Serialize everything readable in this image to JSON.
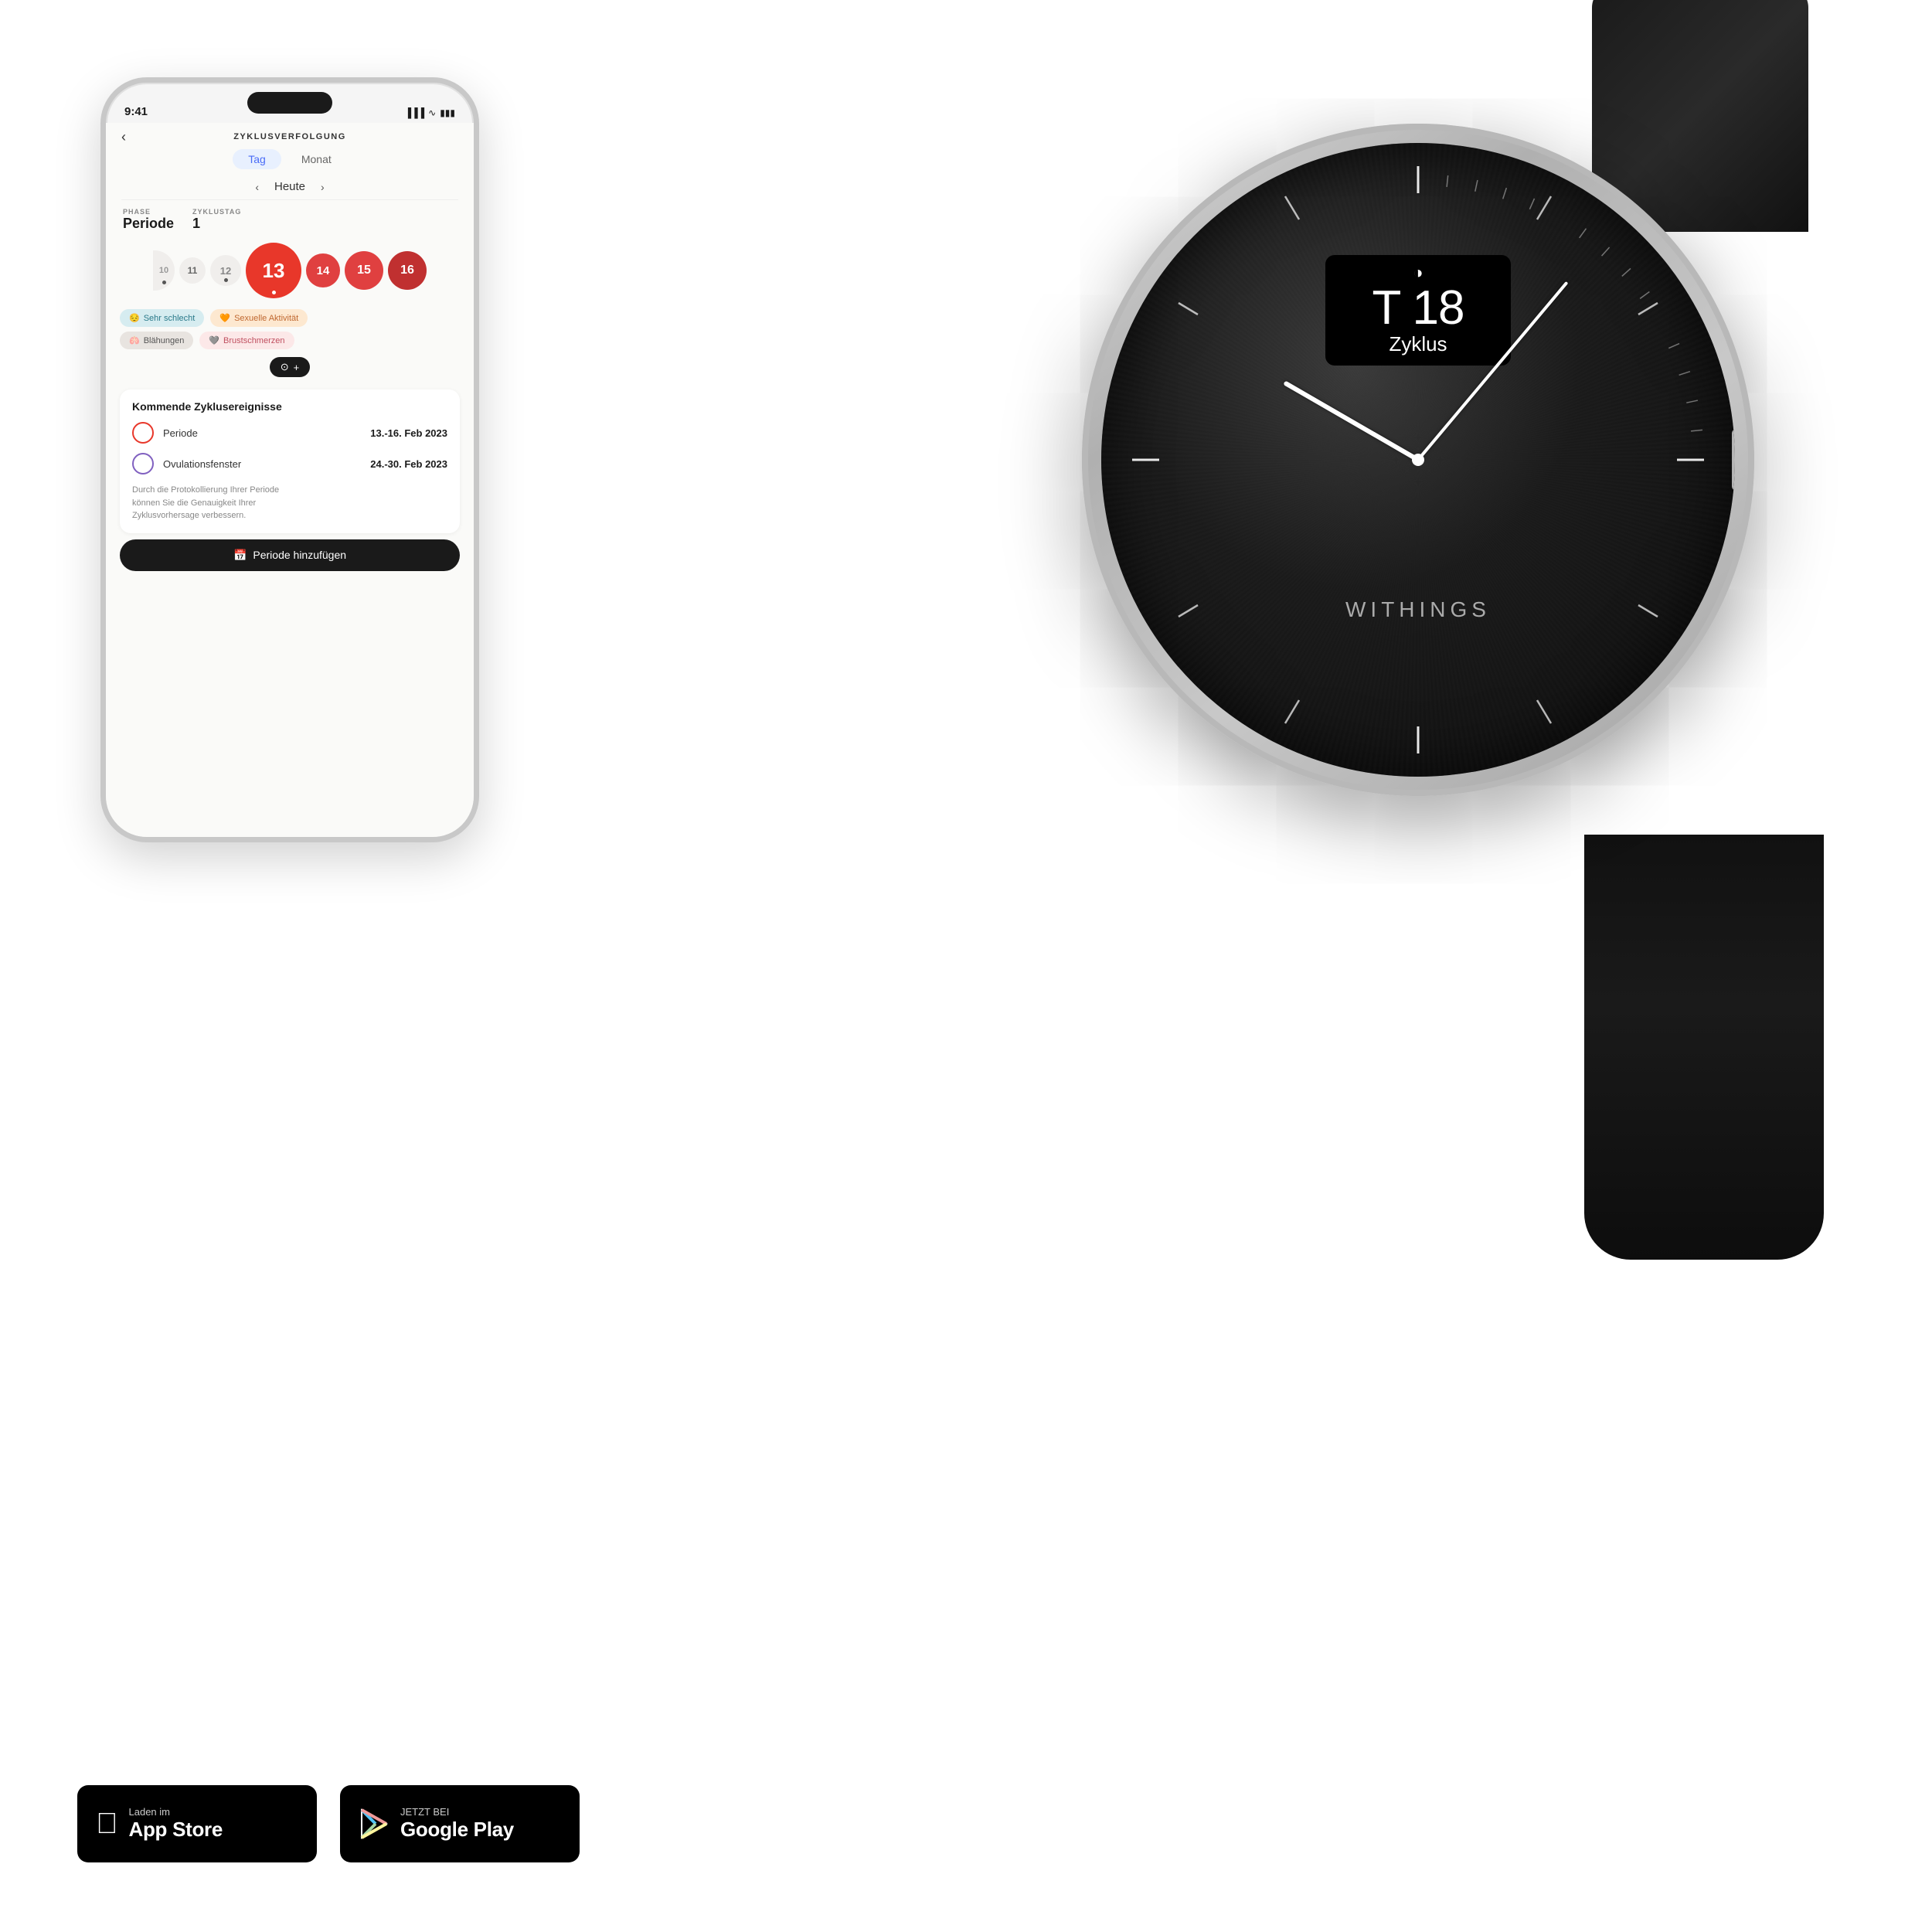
{
  "phone": {
    "status_time": "9:41",
    "app_title": "Zyklusverfolgung",
    "tab_tag": "Tag",
    "tab_monat": "Monat",
    "back_arrow": "‹",
    "date_label": "Heute",
    "phase_label": "PHASE",
    "phase_value": "Periode",
    "zyklustag_label": "ZYKLUSTAG",
    "zyklustag_value": "1",
    "calendar_days": [
      "10",
      "11",
      "12",
      "13",
      "14",
      "15",
      "16"
    ],
    "chip1": "Sehr schlecht",
    "chip2": "Sexuelle Aktivität",
    "chip3": "Blähungen",
    "chip4": "Brustschmerzen",
    "events_title": "Kommende Zyklusereignisse",
    "event1_name": "Periode",
    "event1_date": "13.-16. Feb 2023",
    "event2_name": "Ovulationsfenster",
    "event2_date": "24.-30. Feb 2023",
    "events_note": "Durch die Protokollierung Ihrer Periode\nkönnen Sie die Genauigkeit Ihrer\nZyklusvorhersage verbessern.",
    "bottom_btn": "Periode hinzufügen"
  },
  "watch": {
    "temp_label": "T 18",
    "cycle_label": "Zyklus",
    "brand": "WITHINGS"
  },
  "badges": {
    "appstore_sub": "Laden im",
    "appstore_main": "App Store",
    "googleplay_sub": "JETZT BEI",
    "googleplay_main": "Google Play"
  }
}
